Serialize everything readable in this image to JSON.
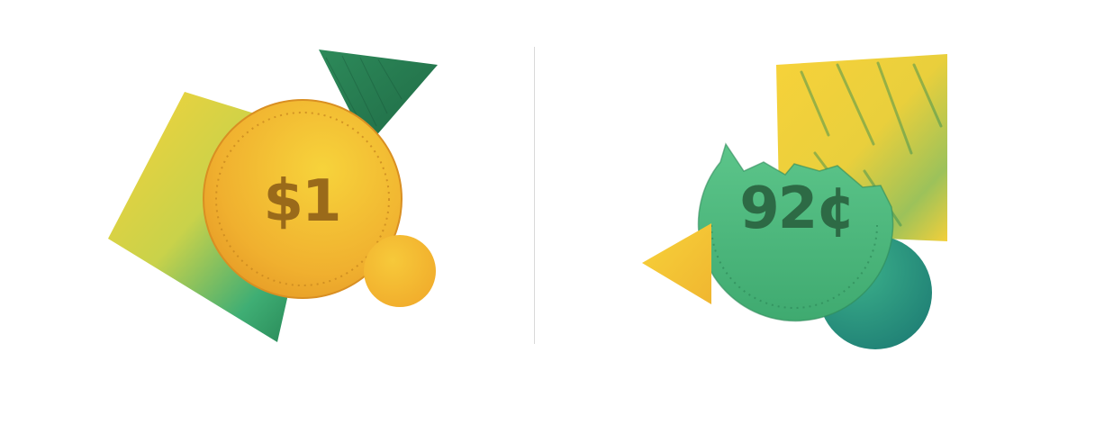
{
  "left_coin": {
    "label": "$1"
  },
  "right_coin": {
    "label": "92¢"
  },
  "colors": {
    "gold": "#f2b632",
    "yellow": "#f7d23a",
    "green": "#3fae74",
    "dark_green": "#1f7a4d",
    "teal": "#2f9a84"
  }
}
